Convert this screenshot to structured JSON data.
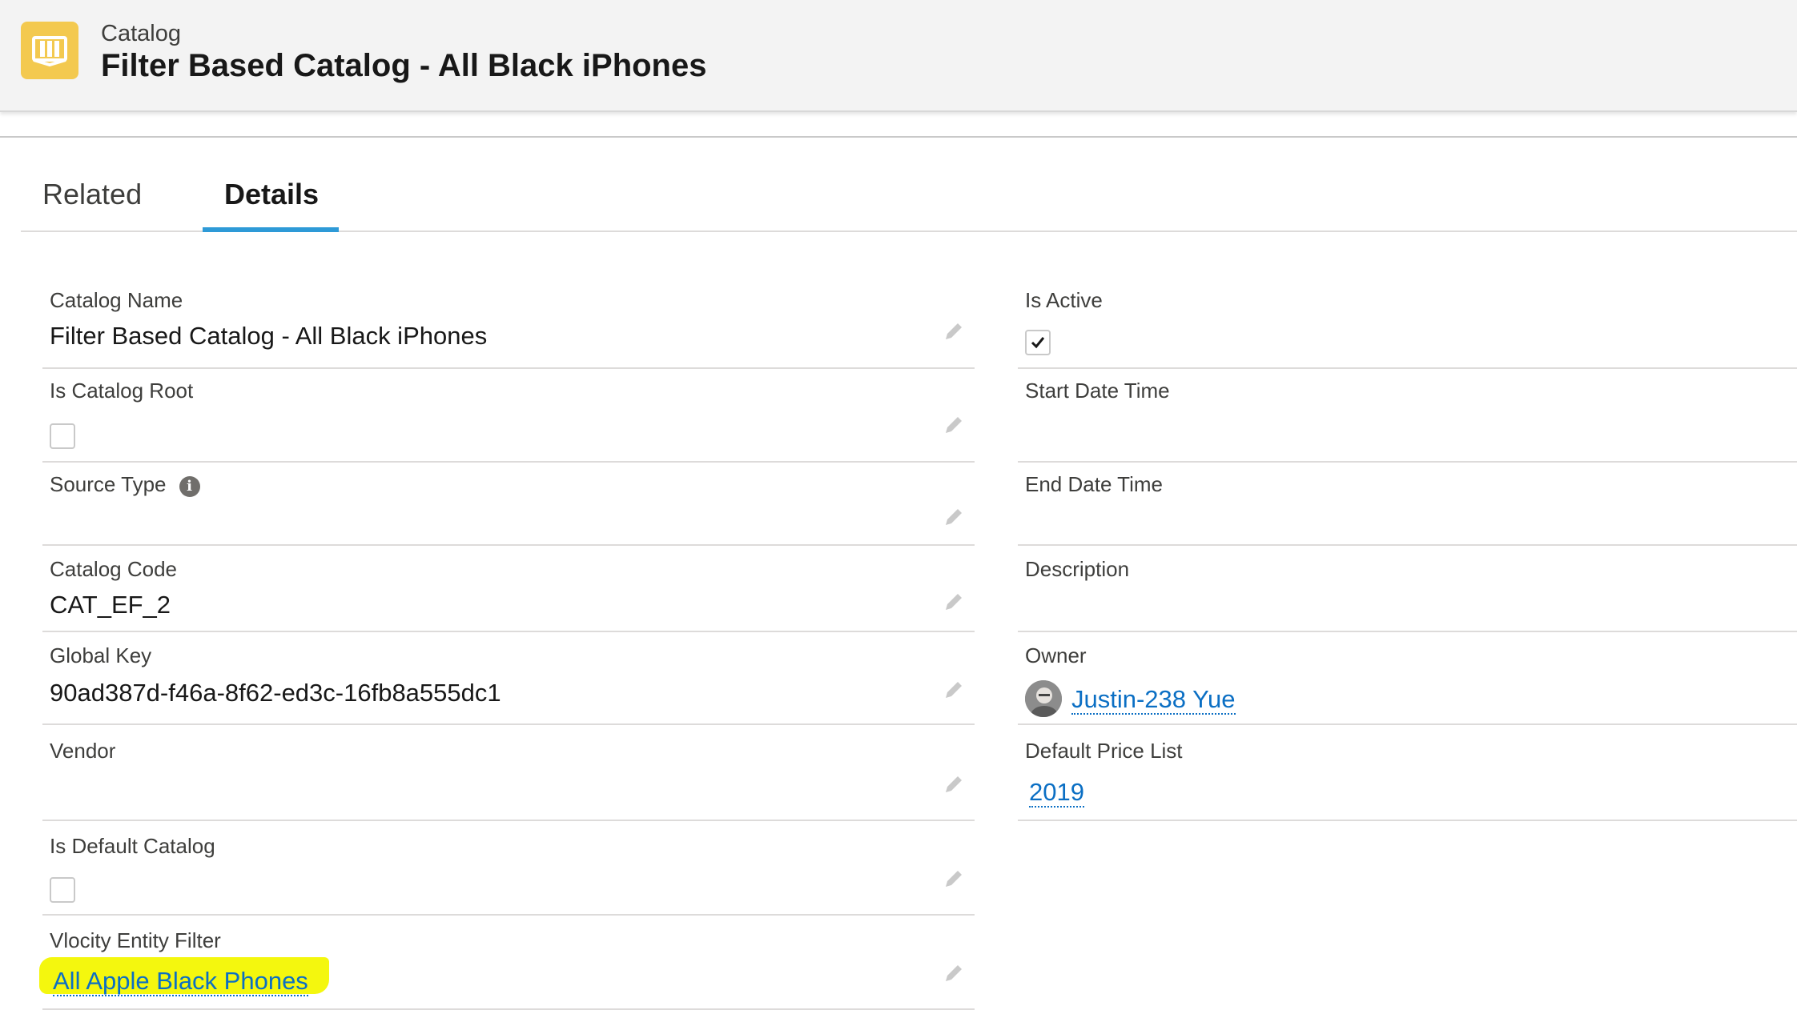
{
  "header": {
    "object_type": "Catalog",
    "title": "Filter Based Catalog - All Black iPhones",
    "icon": "catalog-book-icon",
    "icon_color": "#f3c94f"
  },
  "tabs": [
    {
      "label": "Related",
      "active": false
    },
    {
      "label": "Details",
      "active": true
    }
  ],
  "accent_color": "#2e9ad7",
  "left_fields": {
    "catalog_name": {
      "label": "Catalog Name",
      "value": "Filter Based Catalog - All Black iPhones"
    },
    "is_catalog_root": {
      "label": "Is Catalog Root",
      "checked": false
    },
    "source_type": {
      "label": "Source Type",
      "value": ""
    },
    "catalog_code": {
      "label": "Catalog Code",
      "value": "CAT_EF_2"
    },
    "global_key": {
      "label": "Global Key",
      "value": "90ad387d-f46a-8f62-ed3c-16fb8a555dc1"
    },
    "vendor": {
      "label": "Vendor",
      "value": ""
    },
    "is_default_catalog": {
      "label": "Is Default Catalog",
      "checked": false
    },
    "vlocity_entity_filter": {
      "label": "Vlocity Entity Filter",
      "value": "All Apple Black Phones",
      "highlight_color": "#f4f70e"
    }
  },
  "right_fields": {
    "is_active": {
      "label": "Is Active",
      "checked": true
    },
    "start_date_time": {
      "label": "Start Date Time",
      "value": ""
    },
    "end_date_time": {
      "label": "End Date Time",
      "value": ""
    },
    "description": {
      "label": "Description",
      "value": ""
    },
    "owner": {
      "label": "Owner",
      "value": "Justin-238 Yue"
    },
    "default_price_list": {
      "label": "Default Price List",
      "value": "2019"
    }
  }
}
